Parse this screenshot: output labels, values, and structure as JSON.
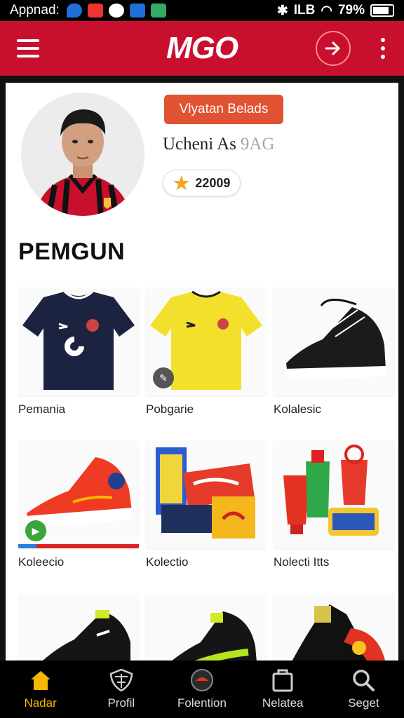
{
  "status_bar": {
    "app_label": "Appnad:",
    "battery_text": "79%",
    "network_text": "ILB"
  },
  "header": {
    "logo": "MGO"
  },
  "profile": {
    "follow_button": "Vlyatan Belads",
    "name": "Uchen",
    "name_tail": "i As",
    "name_suffix": "9AG",
    "points": "22009"
  },
  "section_title": "PEMGUN",
  "products": [
    {
      "label": "Pemania",
      "icon": "navy-jersey"
    },
    {
      "label": "Pobgarie",
      "icon": "yellow-jersey"
    },
    {
      "label": "Kolalesic",
      "icon": "black-sneaker"
    },
    {
      "label": "Koleecio",
      "icon": "red-sneaker"
    },
    {
      "label": "Kolectio",
      "icon": "collector-box-set"
    },
    {
      "label": "Nolecti Itts",
      "icon": "merch-cups"
    },
    {
      "label": "",
      "icon": "black-cleat"
    },
    {
      "label": "",
      "icon": "green-black-cleat"
    },
    {
      "label": "",
      "icon": "red-black-cleat"
    }
  ],
  "tabs": [
    {
      "label": "Nadar",
      "icon": "home-icon",
      "active": true
    },
    {
      "label": "Profil",
      "icon": "shield-icon",
      "active": false
    },
    {
      "label": "Folention",
      "icon": "ball-icon",
      "active": false
    },
    {
      "label": "Nelatea",
      "icon": "bag-icon",
      "active": false
    },
    {
      "label": "Seget",
      "icon": "search-icon",
      "active": false
    }
  ],
  "colors": {
    "brand": "#c8102e",
    "accent": "#e05232",
    "active_tab": "#f5b800"
  }
}
